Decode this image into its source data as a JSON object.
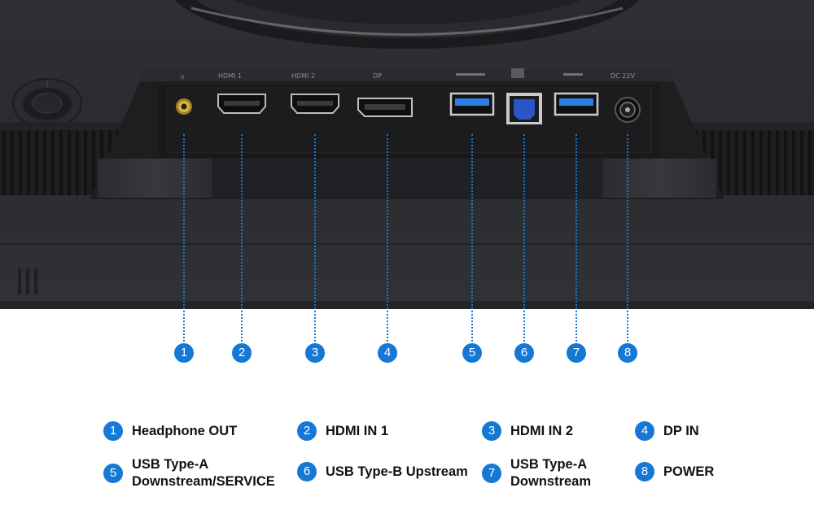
{
  "colors": {
    "accent": "#1478d4",
    "monitor_body": "#2a2b2e",
    "usb_a_blue": "#2a7fe0",
    "usb_b_blue": "#2a55c6",
    "audio_gold": "#c9a33a"
  },
  "panel_labels": [
    "HDMI 1",
    "HDMI 2",
    "DP",
    "DC 22V"
  ],
  "ports": [
    {
      "number": "1",
      "icon": "headphone-jack-icon"
    },
    {
      "number": "2",
      "icon": "hdmi-port-icon"
    },
    {
      "number": "3",
      "icon": "hdmi-port-icon"
    },
    {
      "number": "4",
      "icon": "displayport-icon"
    },
    {
      "number": "5",
      "icon": "usb-a-port-icon"
    },
    {
      "number": "6",
      "icon": "usb-b-port-icon"
    },
    {
      "number": "7",
      "icon": "usb-a-port-icon"
    },
    {
      "number": "8",
      "icon": "dc-power-jack-icon"
    }
  ],
  "legend": [
    {
      "number": "1",
      "label": "Headphone OUT"
    },
    {
      "number": "2",
      "label": "HDMI IN 1"
    },
    {
      "number": "3",
      "label": "HDMI IN 2"
    },
    {
      "number": "4",
      "label": "DP IN"
    },
    {
      "number": "5",
      "label": "USB Type-A\nDownstream/SERVICE"
    },
    {
      "number": "6",
      "label": "USB Type-B Upstream"
    },
    {
      "number": "7",
      "label": "USB Type-A\nDownstream"
    },
    {
      "number": "8",
      "label": "POWER"
    }
  ]
}
